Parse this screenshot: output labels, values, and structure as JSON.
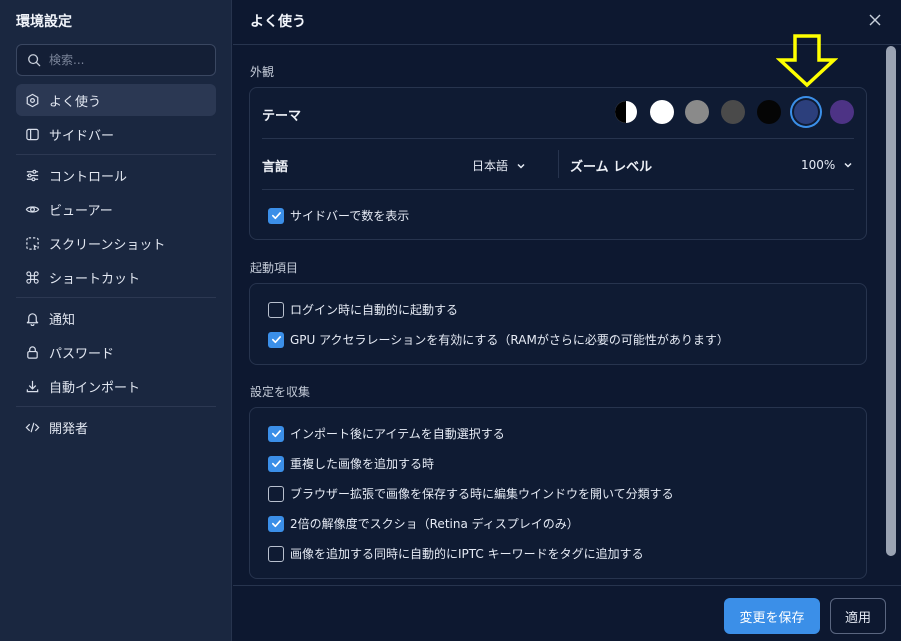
{
  "sidebar": {
    "title": "環境設定",
    "search_placeholder": "検索...",
    "items": [
      {
        "label": "よく使う",
        "icon": "hexagon-icon",
        "active": true
      },
      {
        "label": "サイドバー",
        "icon": "sidebar-panel-icon"
      },
      {
        "label": "コントロール",
        "icon": "sliders-icon"
      },
      {
        "label": "ビューアー",
        "icon": "eye-icon"
      },
      {
        "label": "スクリーンショット",
        "icon": "screenshot-icon"
      },
      {
        "label": "ショートカット",
        "icon": "command-icon"
      },
      {
        "label": "通知",
        "icon": "bell-icon"
      },
      {
        "label": "パスワード",
        "icon": "lock-icon"
      },
      {
        "label": "自動インポート",
        "icon": "download-icon"
      },
      {
        "label": "開発者",
        "icon": "code-icon"
      }
    ]
  },
  "main": {
    "title": "よく使う",
    "appearance": {
      "label": "外観",
      "theme_label": "テーマ",
      "themes": [
        {
          "name": "auto",
          "color": "#ffffff"
        },
        {
          "name": "white",
          "color": "#ffffff"
        },
        {
          "name": "light-gray",
          "color": "#8a8a8a"
        },
        {
          "name": "gray",
          "color": "#4a4a4a"
        },
        {
          "name": "black",
          "color": "#050505"
        },
        {
          "name": "navy",
          "color": "#2c3f7c",
          "selected": true
        },
        {
          "name": "purple",
          "color": "#4d3385"
        }
      ],
      "language_label": "言語",
      "language_value": "日本語",
      "zoom_label": "ズーム レベル",
      "zoom_value": "100%",
      "show_count": {
        "label": "サイドバーで数を表示",
        "checked": true
      }
    },
    "startup": {
      "label": "起動項目",
      "items": [
        {
          "label": "ログイン時に自動的に起動する",
          "checked": false
        },
        {
          "label": "GPU アクセラレーションを有効にする（RAMがさらに必要の可能性があります）",
          "checked": true
        }
      ]
    },
    "collect": {
      "label": "設定を収集",
      "items": [
        {
          "label": "インポート後にアイテムを自動選択する",
          "checked": true
        },
        {
          "label": "重複した画像を追加する時",
          "checked": true
        },
        {
          "label": "ブラウザー拡張で画像を保存する時に編集ウインドウを開いて分類する",
          "checked": false
        },
        {
          "label": "2倍の解像度でスクショ（Retina ディスプレイのみ）",
          "checked": true
        },
        {
          "label": "画像を追加する同時に自動的にIPTC キーワードをタグに追加する",
          "checked": false
        }
      ]
    },
    "footer": {
      "save_label": "変更を保存",
      "apply_label": "適用"
    }
  },
  "colors": {
    "accent": "#3b8fe8",
    "annotation_arrow": "#ffff00"
  }
}
